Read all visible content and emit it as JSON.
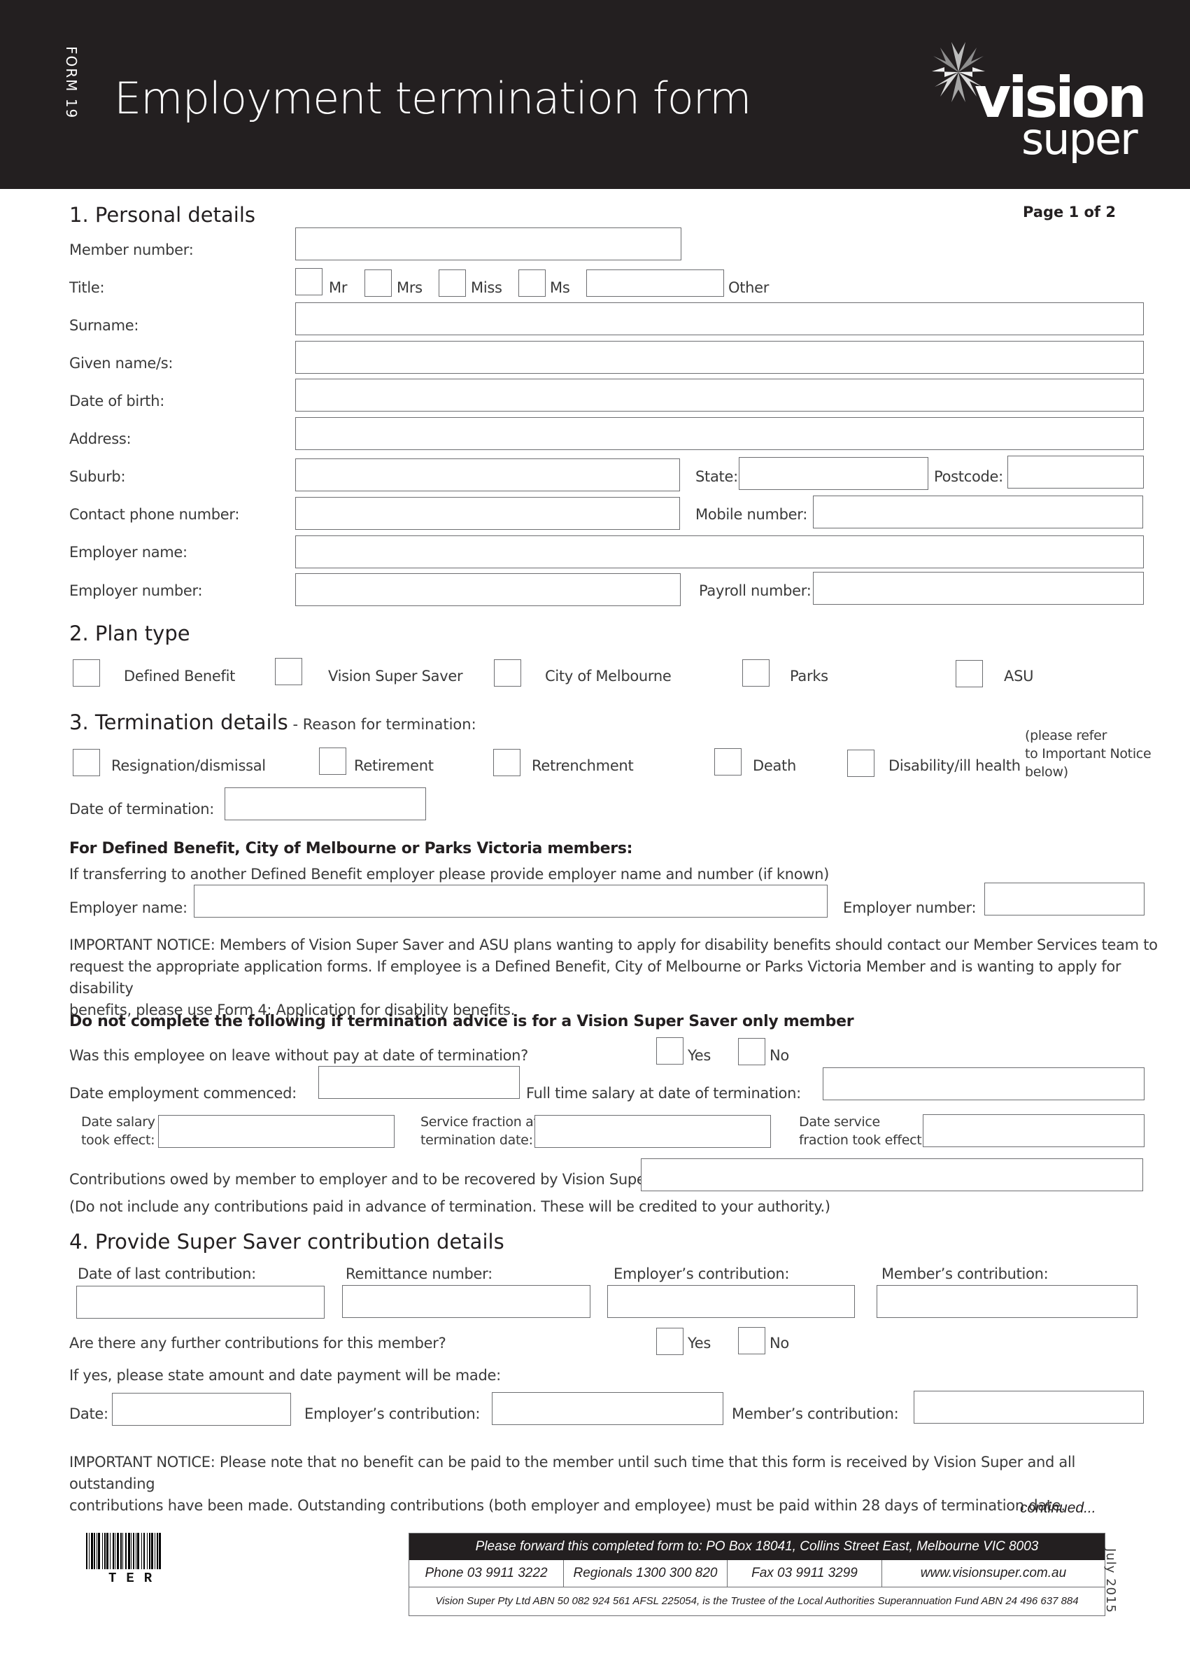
{
  "header": {
    "form_number": "FORM 19",
    "title": "Employment termination form",
    "logo_line1": "vision",
    "logo_line2": "super"
  },
  "page_indicator": "Page 1 of 2",
  "section1": {
    "heading": "1.  Personal details",
    "member_number_label": "Member number:",
    "title_label": "Title:",
    "title_options": [
      "Mr",
      "Mrs",
      "Miss",
      "Ms"
    ],
    "title_other_label": "Other",
    "surname_label": "Surname:",
    "given_names_label": "Given name/s:",
    "dob_label": "Date of birth:",
    "address_label": "Address:",
    "suburb_label": "Suburb:",
    "state_label": "State:",
    "postcode_label": "Postcode:",
    "contact_phone_label": "Contact phone number:",
    "mobile_label": "Mobile number:",
    "employer_name_label": "Employer name:",
    "employer_number_label": "Employer number:",
    "payroll_number_label": "Payroll number:"
  },
  "section2": {
    "heading": "2.  Plan type",
    "options": [
      "Defined Benefit",
      "Vision Super Saver",
      "City of Melbourne",
      "Parks",
      "ASU"
    ]
  },
  "section3": {
    "heading": "3.  Termination details",
    "subheading": " - Reason for termination:",
    "reasons": [
      "Resignation/dismissal",
      "Retirement",
      "Retrenchment",
      "Death",
      "Disability/ill health"
    ],
    "disability_note_lines": [
      "(please refer",
      "to Important Notice",
      "below)"
    ],
    "date_of_termination_label": "Date of termination:",
    "db_heading": "For Defined Benefit, City of Melbourne or Parks Victoria members:",
    "db_instruction": "If transferring to another Defined Benefit employer please provide employer name and number (if known)",
    "db_employer_name_label": "Employer name:",
    "db_employer_number_label": "Employer number:",
    "important_notice_lines": [
      "IMPORTANT NOTICE: Members of Vision Super Saver and ASU plans wanting to apply for disability benefits should contact our Member Services team to",
      "request the appropriate application forms. If employee is a Defined Benefit, City of Melbourne or Parks Victoria Member and is wanting to apply for disability",
      "benefits, please use Form 4: Application for disability benefits."
    ],
    "not_saver_heading": "Do not complete the following if termination advice is for a Vision Super Saver only member",
    "leave_without_pay_question": "Was this employee on leave without pay at date of termination?",
    "yes_label": "Yes",
    "no_label": "No",
    "date_employment_commenced_label": "Date employment commenced:",
    "full_time_salary_label": "Full time salary at date of termination:",
    "date_salary_took_effect_lines": [
      "Date salary",
      "took effect:"
    ],
    "service_fraction_lines": [
      "Service fraction at",
      "termination date:"
    ],
    "date_service_fraction_lines": [
      "Date service",
      "fraction took effect:"
    ],
    "contributions_owed_label": "Contributions owed by member to employer and to be recovered by Vision Super:",
    "contributions_note": "(Do not include any contributions paid in advance of termination. These will be credited to your authority.)"
  },
  "section4": {
    "heading": "4.  Provide Super Saver contribution details",
    "columns": [
      "Date of last contribution:",
      "Remittance number:",
      "Employer’s contribution:",
      "Member’s contribution:"
    ],
    "further_contributions_question": "Are there any further contributions for this member?",
    "yes_label": "Yes",
    "no_label": "No",
    "if_yes_instruction": "If yes, please state amount and date payment will be made:",
    "date_label": "Date:",
    "employer_contribution_label": "Employer’s contribution:",
    "member_contribution_label": "Member’s contribution:",
    "important_notice_lines": [
      "IMPORTANT NOTICE: Please note that no benefit can be paid to the member until such time that this form is received by Vision Super and all outstanding",
      "contributions have been made. Outstanding contributions (both employer and employee) must be paid within 28 days of termination date."
    ],
    "continued": "continued..."
  },
  "footer": {
    "barcode_text": "TER",
    "forward_address": "Please forward this completed form to: PO Box 18041, Collins Street East, Melbourne   VIC   8003",
    "phone": "Phone 03 9911 3222",
    "regionals": "Regionals 1300 300 820",
    "fax": "Fax 03 9911 3299",
    "website": "www.visionsuper.com.au",
    "trustee_note": "Vision Super Pty Ltd ABN 50 082 924 561 AFSL 225054, is the Trustee of the Local Authorities Superannuation Fund ABN 24 496 637 884",
    "edition": "July  2015"
  }
}
